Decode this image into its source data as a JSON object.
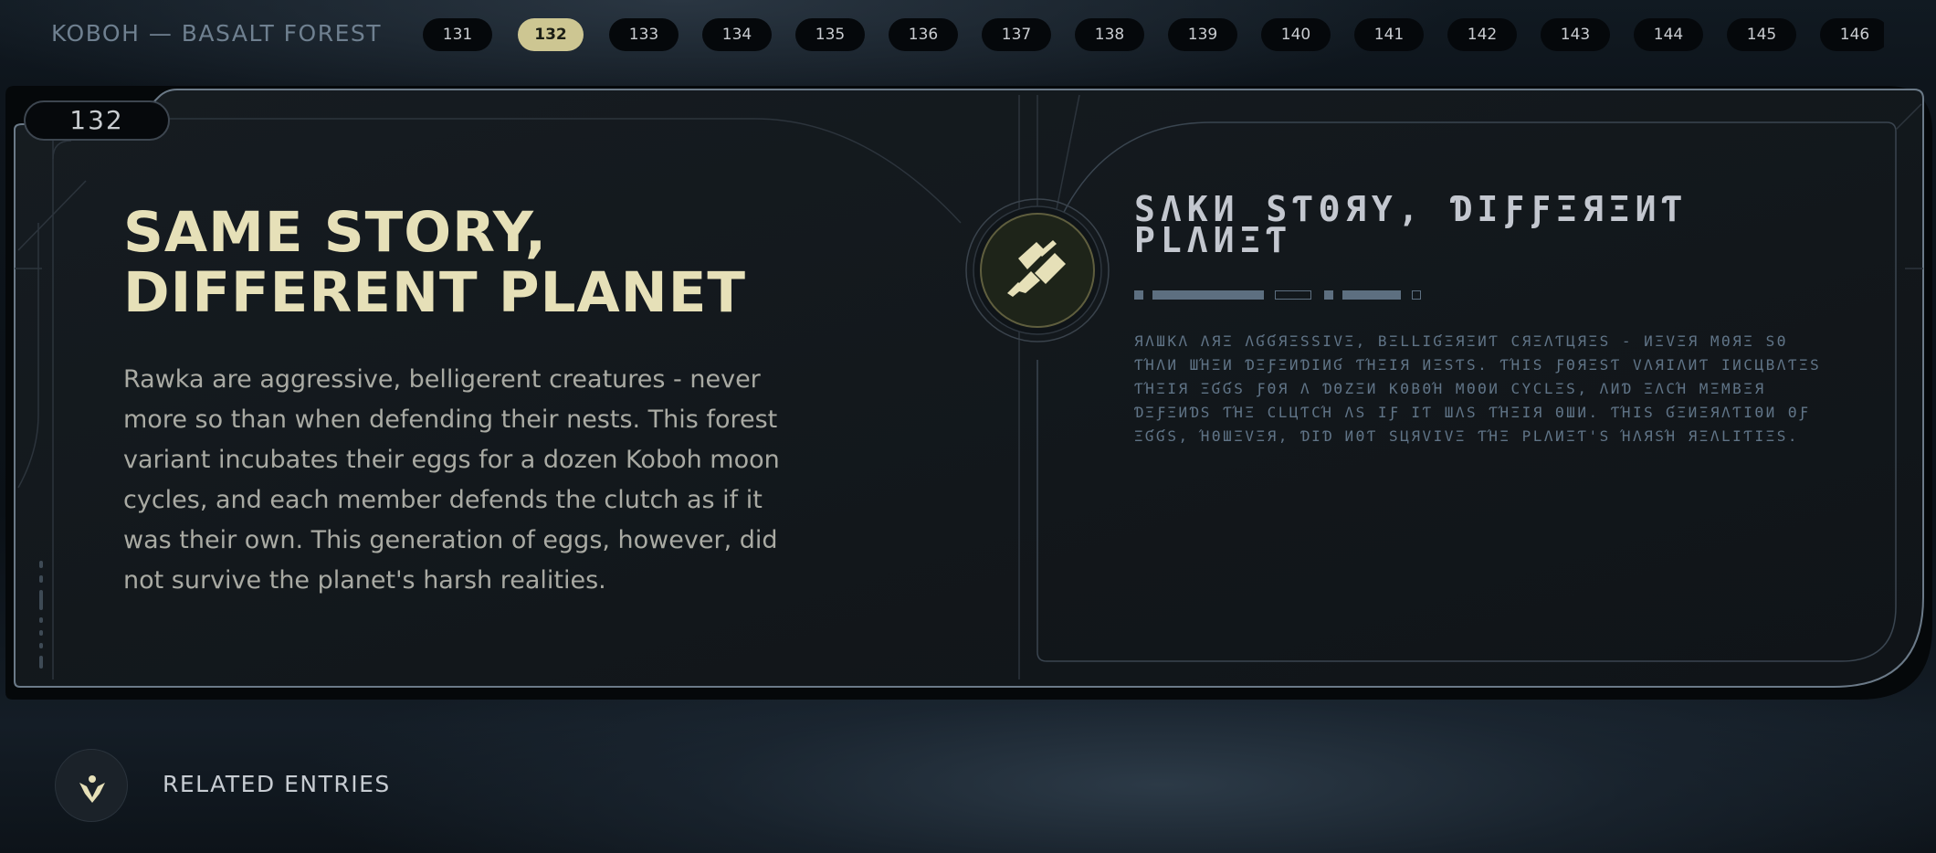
{
  "header": {
    "location": "KOBOH — BASALT FOREST",
    "pages": [
      "131",
      "132",
      "133",
      "134",
      "135",
      "136",
      "137",
      "138",
      "139",
      "140",
      "141",
      "142",
      "143",
      "144",
      "145",
      "146"
    ],
    "active_page": "132"
  },
  "entry": {
    "number": "132",
    "title": "SAME STORY, DIFFERENT PLANET",
    "body": "Rawka are aggressive, belligerent creatures - never more so than when defending their nests. This forest variant incubates their eggs for a dozen Koboh moon cycles, and each member defends the clutch as if it was their own. This generation of eggs, however, did not survive the planet's harsh realities.",
    "emblem_icon": "rawka-creature-icon",
    "aurebesh_title": "ЅΛКИ ЅƬΘЯΥ, ƊΙƑƑΞЯΞИƬ ΡLΛИΞƬ",
    "aurebesh_body": "ЯΛШКΛ ΛЯΞ ΛƓƓЯΞЅЅΙVΞ, ВΞLLΙƓΞЯΞИƬ ϹЯΞΛƬЦЯΞЅ - ИΞVΞЯ ΜΘЯΞ ЅΘ ƬΉΛИ ШΉΞИ ƊΞƑΞИƊΙИƓ ƬΉΞΙЯ ИΞЅƬЅ. ƬΉΙЅ ƑΘЯΞЅƬ VΛЯΙΛИƬ ΙИϹЦВΛƬΞЅ ƬΉΞΙЯ ΞƓƓЅ ƑΘЯ Λ ƊΘΖΞИ КΘВΘΉ ΜΘΘИ ϹΥϹLΞЅ, ΛИƊ ΞΛϹΉ ΜΞΜВΞЯ ƊΞƑΞИƊЅ ƬΉΞ ϹLЦƬϹΉ ΛЅ ΙƑ ΙƬ ШΛЅ ƬΉΞΙЯ ΘШИ. ƬΉΙЅ ƓΞИΞЯΛƬΙΘИ ΘƑ ΞƓƓЅ, ΉΘШΞVΞЯ, ƊΙƊ ИΘƬ ЅЦЯVΙVΞ ƬΉΞ ΡLΛИΞƬ'Ѕ ΉΛЯЅΉ ЯΞΛLΙƬΙΞЅ."
  },
  "related": {
    "label": "RELATED ENTRIES",
    "icon": "related-entries-icon"
  },
  "colors": {
    "accent": "#cdc692",
    "title": "#e6e0b8",
    "body_text": "#a9aaa3",
    "aurebesh_title": "#c3c7cf",
    "aurebesh_body": "#607487",
    "frame_line": "#5b6b7a"
  }
}
